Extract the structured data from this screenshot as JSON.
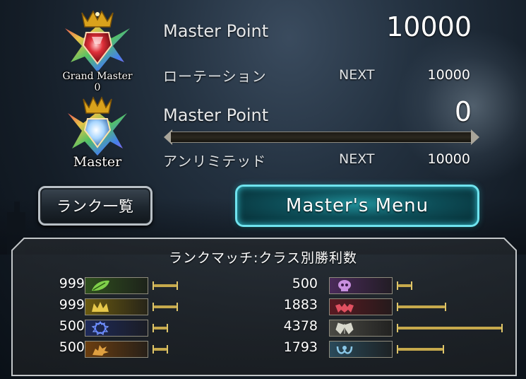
{
  "rotation": {
    "rank_name": "Grand Master 0",
    "point_label": "Master Point",
    "point_value": "10000",
    "format_label": "ローテーション",
    "next_label": "NEXT",
    "next_value": "10000"
  },
  "unlimited": {
    "rank_name": "Master",
    "point_label": "Master Point",
    "point_value": "0",
    "format_label": "アンリミテッド",
    "next_label": "NEXT",
    "next_value": "10000",
    "progress": 0
  },
  "buttons": {
    "rank_list": "ランク一覧",
    "masters_menu": "Master's Menu"
  },
  "wins_panel": {
    "title": "ランクマッチ:クラス別勝利数",
    "classes": [
      {
        "icon": "forestcraft-leaf-icon",
        "wins": "999",
        "bar": 0.22,
        "color": "#2f4f1e"
      },
      {
        "icon": "swordcraft-crown-icon",
        "wins": "999",
        "bar": 0.22,
        "color": "#6a5a10"
      },
      {
        "icon": "runecraft-circle-icon",
        "wins": "500",
        "bar": 0.12,
        "color": "#1e2a5a"
      },
      {
        "icon": "dragoncraft-dragon-icon",
        "wins": "500",
        "bar": 0.12,
        "color": "#6b3e10"
      },
      {
        "icon": "shadowcraft-skull-icon",
        "wins": "500",
        "bar": 0.12,
        "color": "#4a2a5a"
      },
      {
        "icon": "bloodcraft-bat-icon",
        "wins": "1883",
        "bar": 0.45,
        "color": "#5a1a22"
      },
      {
        "icon": "havencraft-wings-icon",
        "wins": "4378",
        "bar": 1.0,
        "color": "#4a4a44"
      },
      {
        "icon": "portalcraft-gear-icon",
        "wins": "1793",
        "bar": 0.43,
        "color": "#2a4a5a"
      }
    ]
  }
}
